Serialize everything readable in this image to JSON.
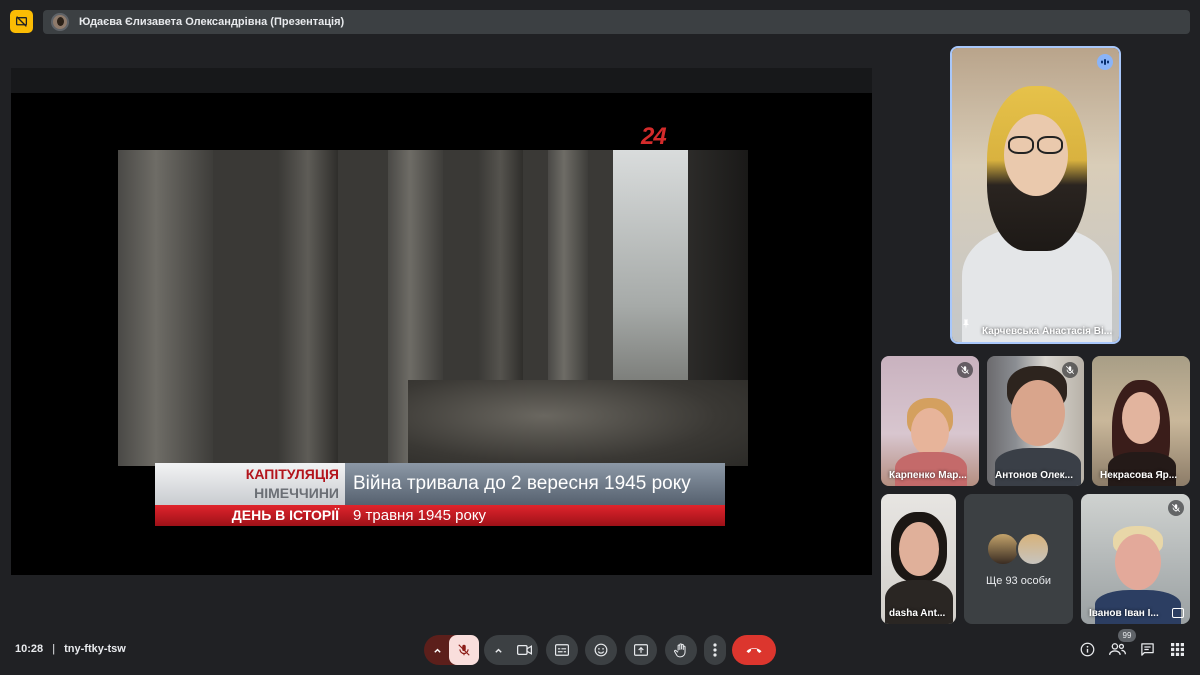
{
  "header": {
    "presenter_label": "Юдаєва Єлизавета Олександрівна (Презентація)"
  },
  "presentation": {
    "channel_logo": "24",
    "caption_topic_line1": "КАПІТУЛЯЦІЯ",
    "caption_topic_line2": "НІМЕЧЧИНИ",
    "caption_main": "Війна тривала до 2 вересня 1945 року",
    "caption_band_label": "ДЕНЬ В ІСТОРІЇ",
    "caption_band_date": "9 травня 1945 року"
  },
  "participants": {
    "speaker": {
      "name": "Карчевська Анастасія Ві..."
    },
    "tiles": [
      {
        "name": "Карпенко Мар..."
      },
      {
        "name": "Антонов Олек..."
      },
      {
        "name": "Некрасова Яр..."
      },
      {
        "name": "dasha Ant..."
      },
      {
        "name": "Іванов Іван І..."
      }
    ],
    "more_label": "Ще 93 особи"
  },
  "footer": {
    "time": "10:28",
    "separator": "|",
    "meeting_code": "tny-ftky-tsw",
    "people_count": "99"
  },
  "colors": {
    "background": "#202124",
    "surface": "#3c4043",
    "present_accent": "#fbbc04",
    "mic_off_bg": "#f9dedc",
    "hangup": "#dc362e",
    "speaker_outline": "#a8c7fa"
  },
  "icons": [
    "stop-presenting-icon",
    "pin-icon",
    "mic-off-icon",
    "audio-level-icon",
    "chevron-up-icon",
    "camera-icon",
    "captions-icon",
    "emoji-icon",
    "present-icon",
    "raise-hand-icon",
    "more-options-icon",
    "call-end-icon",
    "info-icon",
    "people-icon",
    "chat-icon",
    "activities-icon"
  ]
}
